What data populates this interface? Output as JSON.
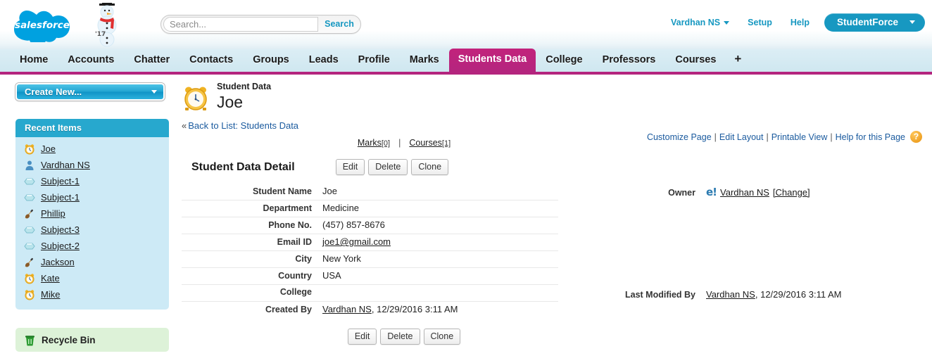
{
  "header": {
    "logo_text": "salesforce",
    "mascot_year": "'17",
    "search": {
      "placeholder": "Search...",
      "value": "",
      "button_label": "Search"
    },
    "user_menu": "Vardhan NS",
    "setup_link": "Setup",
    "help_link": "Help",
    "app_menu": "StudentForce"
  },
  "tabs": [
    {
      "label": "Home",
      "active": false
    },
    {
      "label": "Accounts",
      "active": false
    },
    {
      "label": "Chatter",
      "active": false
    },
    {
      "label": "Contacts",
      "active": false
    },
    {
      "label": "Groups",
      "active": false
    },
    {
      "label": "Leads",
      "active": false
    },
    {
      "label": "Profile",
      "active": false
    },
    {
      "label": "Marks",
      "active": false
    },
    {
      "label": "Students Data",
      "active": true
    },
    {
      "label": "College",
      "active": false
    },
    {
      "label": "Professors",
      "active": false
    },
    {
      "label": "Courses",
      "active": false
    },
    {
      "label": "+",
      "active": false
    }
  ],
  "sidebar": {
    "create_new_label": "Create New...",
    "recent_items_title": "Recent Items",
    "recent_items": [
      {
        "label": "Joe",
        "icon": "alarm-clock-icon"
      },
      {
        "label": "Vardhan NS",
        "icon": "user-icon"
      },
      {
        "label": "Subject-1",
        "icon": "hexagon-icon"
      },
      {
        "label": "Subject-1",
        "icon": "hexagon-icon"
      },
      {
        "label": "Phillip",
        "icon": "violin-icon"
      },
      {
        "label": "Subject-3",
        "icon": "hexagon-icon"
      },
      {
        "label": "Subject-2",
        "icon": "hexagon-icon"
      },
      {
        "label": "Jackson",
        "icon": "violin-icon"
      },
      {
        "label": "Kate",
        "icon": "alarm-clock-icon"
      },
      {
        "label": "Mike",
        "icon": "alarm-clock-icon"
      }
    ],
    "recycle_bin_label": "Recycle Bin"
  },
  "record": {
    "type_label": "Student Data",
    "title": "Joe",
    "back_link": "Back to List: Students Data",
    "back_chevron": "«"
  },
  "utility_links": {
    "customize_page": "Customize Page",
    "edit_layout": "Edit Layout",
    "printable_view": "Printable View",
    "help_for_page": "Help for this Page",
    "separator": "|",
    "help_glyph": "?"
  },
  "related_links": [
    {
      "label": "Marks",
      "count": "[0]"
    },
    {
      "label": "Courses",
      "count": "[1]"
    }
  ],
  "detail": {
    "section_title": "Student Data Detail",
    "buttons": [
      "Edit",
      "Delete",
      "Clone"
    ],
    "left_fields": [
      {
        "label": "Student Name",
        "value": "Joe",
        "link": false
      },
      {
        "label": "Department",
        "value": "Medicine",
        "link": false
      },
      {
        "label": "Phone No.",
        "value": "(457) 857-8676",
        "link": false
      },
      {
        "label": "Email ID",
        "value": "joe1@gmail.com",
        "link": true
      },
      {
        "label": "City",
        "value": "New York",
        "link": false
      },
      {
        "label": "Country",
        "value": "USA",
        "link": false
      },
      {
        "label": "College",
        "value": "",
        "link": false
      }
    ],
    "created_by": {
      "label": "Created By",
      "user": "Vardhan NS",
      "timestamp": ", 12/29/2016 3:11 AM"
    },
    "owner": {
      "label": "Owner",
      "icon": "e!",
      "user": "Vardhan NS",
      "change_link": "[Change]"
    },
    "last_modified_by": {
      "label": "Last Modified By",
      "user": "Vardhan NS",
      "timestamp": ", 12/29/2016 3:11 AM"
    }
  }
}
